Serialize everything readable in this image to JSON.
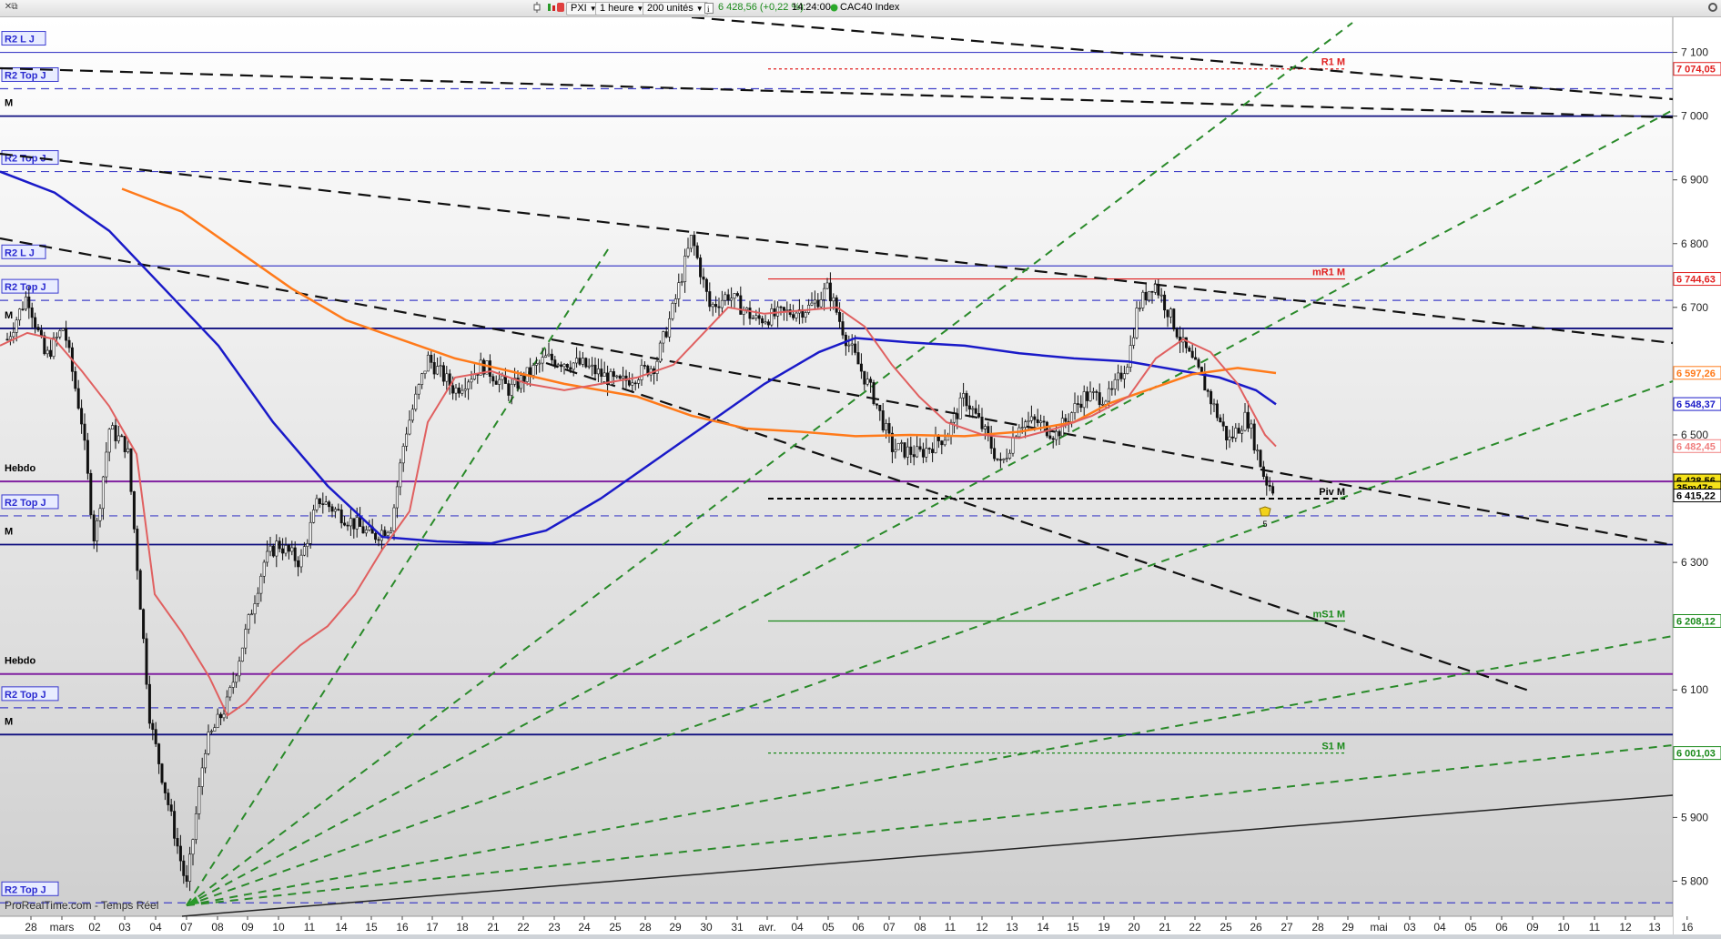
{
  "toolbar": {
    "ticker": "PXI",
    "timeframe": "1 heure",
    "units": "200 unités",
    "quote": "6 428,56 (+0,22 %)",
    "time": "14:24:00",
    "instrument": "CAC40 Index",
    "icons": [
      "candlestick-icon",
      "chart-tools-icon",
      "color-icon",
      "info-icon",
      "status-dot-icon",
      "close-icon",
      "restore-icon",
      "settings-icon"
    ]
  },
  "watermark": "ProRealTime.com - Temps Réel",
  "chart_data": {
    "type": "candlestick",
    "title": "CAC40 Index",
    "timeframe": "1 heure",
    "ylim": [
      5745,
      7155
    ],
    "y_ticks": [
      {
        "label": "7 100",
        "value": 7100
      },
      {
        "label": "7 000",
        "value": 7000
      },
      {
        "label": "6 900",
        "value": 6900
      },
      {
        "label": "6 800",
        "value": 6800
      },
      {
        "label": "6 700",
        "value": 6700
      },
      {
        "label": "6 500",
        "value": 6500
      },
      {
        "label": "6 300",
        "value": 6300
      },
      {
        "label": "6 100",
        "value": 6100
      },
      {
        "label": "5 900",
        "value": 5900
      },
      {
        "label": "5 800",
        "value": 5800
      }
    ],
    "x_ticks": [
      "28",
      "mars",
      "02",
      "03",
      "04",
      "07",
      "08",
      "09",
      "10",
      "11",
      "14",
      "15",
      "16",
      "17",
      "18",
      "21",
      "22",
      "23",
      "24",
      "25",
      "28",
      "29",
      "30",
      "31",
      "avr.",
      "04",
      "05",
      "06",
      "07",
      "08",
      "11",
      "12",
      "13",
      "14",
      "15",
      "19",
      "20",
      "21",
      "22",
      "25",
      "26",
      "27",
      "28",
      "29",
      "mai",
      "03",
      "04",
      "05",
      "06",
      "09",
      "10",
      "11",
      "12",
      "13",
      "16"
    ],
    "price_tags": [
      {
        "label": "7 074,05",
        "value": 7074.05,
        "color": "#e02020",
        "fill": "#ffffff"
      },
      {
        "label": "6 744,63",
        "value": 6744.63,
        "color": "#e02020",
        "fill": "#ffffff"
      },
      {
        "label": "6 597,26",
        "value": 6597.26,
        "color": "#ff7a1a",
        "fill": "#ffffff"
      },
      {
        "label": "6 548,37",
        "value": 6548.37,
        "color": "#1a1ac8",
        "fill": "#ffffff"
      },
      {
        "label": "6 482,45",
        "value": 6482.45,
        "color": "#f08080",
        "fill": "#ffffff"
      },
      {
        "label": "6 428,56",
        "value": 6428.56,
        "color": "#000000",
        "fill": "#f5e21a"
      },
      {
        "label": "35m47s",
        "value": 6417,
        "color": "#000000",
        "fill": "#f5e21a"
      },
      {
        "label": "6 415,22",
        "value": 6405,
        "color": "#000000",
        "fill": "#ffffff"
      },
      {
        "label": "6 208,12",
        "value": 6208.12,
        "color": "#1a8a1a",
        "fill": "#ffffff"
      },
      {
        "label": "6 001,03",
        "value": 6001.03,
        "color": "#1a8a1a",
        "fill": "#ffffff"
      }
    ],
    "h_levels": [
      {
        "label": "R2 L J",
        "value": 7100,
        "color": "#4040c8",
        "style": "solid"
      },
      {
        "label": "R2 Top J",
        "value": 7043,
        "color": "#4040c8",
        "style": "dashed"
      },
      {
        "label": "M",
        "value": 7000,
        "color": "#101080",
        "style": "solid"
      },
      {
        "label": "R2 Top J",
        "value": 6913,
        "color": "#4040c8",
        "style": "dashed"
      },
      {
        "label": "R2 L J",
        "value": 6765,
        "color": "#4040c8",
        "style": "solid"
      },
      {
        "label": "R2 Top J",
        "value": 6711,
        "color": "#4040c8",
        "style": "dashed"
      },
      {
        "label": "M",
        "value": 6667,
        "color": "#101080",
        "style": "solid"
      },
      {
        "label": "Hebdo",
        "value": 6427,
        "color": "#8020a0",
        "style": "solid"
      },
      {
        "label": "R2 Top J",
        "value": 6373,
        "color": "#4040c8",
        "style": "dashed"
      },
      {
        "label": "M",
        "value": 6328,
        "color": "#101080",
        "style": "solid"
      },
      {
        "label": "Hebdo",
        "value": 6125,
        "color": "#8020a0",
        "style": "solid"
      },
      {
        "label": "R2 Top J",
        "value": 6072,
        "color": "#4040c8",
        "style": "dashed"
      },
      {
        "label": "M",
        "value": 6030,
        "color": "#101080",
        "style": "solid"
      },
      {
        "label": "R2 Top J",
        "value": 5766,
        "color": "#4040c8",
        "style": "dashed"
      }
    ],
    "pivots": [
      {
        "label": "R1 M",
        "value": 7074.05,
        "color": "#e02020",
        "style": "dotted"
      },
      {
        "label": "mR1 M",
        "value": 6744.63,
        "color": "#e02020",
        "style": "solid"
      },
      {
        "label": "Piv M",
        "value": 6400,
        "color": "#000000",
        "style": "dashed"
      },
      {
        "label": "mS1 M",
        "value": 6208.12,
        "color": "#1a8a1a",
        "style": "solid"
      },
      {
        "label": "S1 M",
        "value": 6001.03,
        "color": "#1a8a1a",
        "style": "dotted"
      }
    ],
    "annotation": {
      "label": "5",
      "value": 6370
    },
    "series": [
      {
        "name": "",
        "type": "moving-average",
        "color": "#1a1ac8"
      },
      {
        "name": "",
        "type": "moving-average",
        "color": "#ff7a1a"
      },
      {
        "name": "",
        "type": "moving-average",
        "color": "#e06060"
      }
    ],
    "candles_summary": {
      "open": 6800,
      "low": 5760,
      "high": 6830,
      "last": 6428.56
    }
  }
}
